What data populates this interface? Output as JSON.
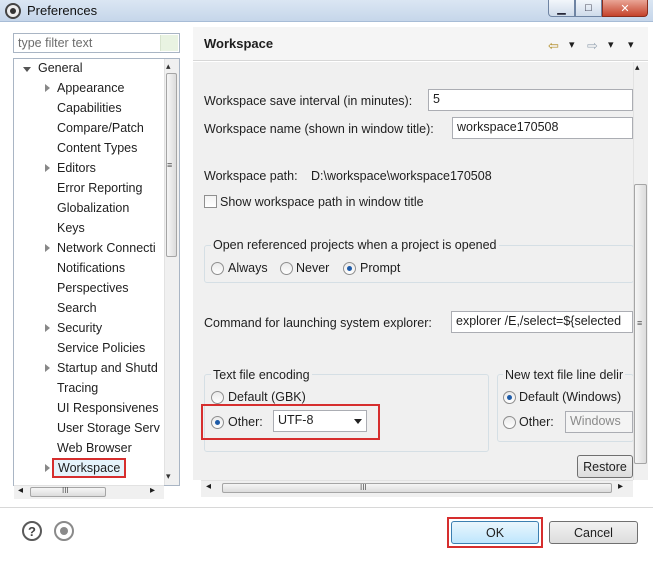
{
  "window": {
    "title": "Preferences",
    "minimize_glyph": "▁",
    "maximize_glyph": "□",
    "close_glyph": "✕"
  },
  "filter": {
    "placeholder": "type filter text"
  },
  "tree": {
    "root": "General",
    "items": [
      {
        "label": "Appearance",
        "expandable": true
      },
      {
        "label": "Capabilities",
        "expandable": false
      },
      {
        "label": "Compare/Patch",
        "expandable": false
      },
      {
        "label": "Content Types",
        "expandable": false
      },
      {
        "label": "Editors",
        "expandable": true
      },
      {
        "label": "Error Reporting",
        "expandable": false
      },
      {
        "label": "Globalization",
        "expandable": false
      },
      {
        "label": "Keys",
        "expandable": false
      },
      {
        "label": "Network Connecti",
        "expandable": true
      },
      {
        "label": "Notifications",
        "expandable": false
      },
      {
        "label": "Perspectives",
        "expandable": false
      },
      {
        "label": "Search",
        "expandable": false
      },
      {
        "label": "Security",
        "expandable": true
      },
      {
        "label": "Service Policies",
        "expandable": false
      },
      {
        "label": "Startup and Shutd",
        "expandable": true
      },
      {
        "label": "Tracing",
        "expandable": false
      },
      {
        "label": "UI Responsivenes",
        "expandable": false
      },
      {
        "label": "User Storage Serv",
        "expandable": false
      },
      {
        "label": "Web Browser",
        "expandable": false
      },
      {
        "label": "Workspace",
        "expandable": true,
        "selected": true
      }
    ],
    "scroll_glyph_left": "◂",
    "scroll_glyph_right": "▸",
    "scroll_glyph_up": "▴",
    "scroll_glyph_down": "▾",
    "grip": "III"
  },
  "page": {
    "title": "Workspace",
    "nav_back": "⇦",
    "nav_forward": "⇨",
    "nav_menu": "▾",
    "save_interval_label": "Workspace save interval (in minutes):",
    "save_interval_value": "5",
    "name_label": "Workspace name (shown in window title):",
    "name_value": "workspace170508",
    "path_label": "Workspace path:",
    "path_value": "D:\\workspace\\workspace170508",
    "show_path_label": "Show workspace path in window title",
    "open_ref_group": "Open referenced projects when a project is opened",
    "open_ref_options": [
      "Always",
      "Never",
      "Prompt"
    ],
    "open_ref_selected": "Prompt",
    "command_label": "Command for launching system explorer:",
    "command_value": "explorer /E,/select=${selected",
    "encoding_group": "Text file encoding",
    "encoding_default": "Default (GBK)",
    "encoding_other": "Other:",
    "encoding_value": "UTF-8",
    "line_delim_group": "New text file line delir",
    "line_delim_default": "Default (Windows)",
    "line_delim_other": "Other:",
    "line_delim_value": "Windows",
    "restore_label": "Restore",
    "grip": "III"
  },
  "footer": {
    "help_glyph": "?",
    "ok_label": "OK",
    "cancel_label": "Cancel"
  },
  "colors": {
    "highlight_box": "#d62e2e",
    "radio_dot": "#1e5ba8",
    "nav_arrow": "#b08a22"
  }
}
